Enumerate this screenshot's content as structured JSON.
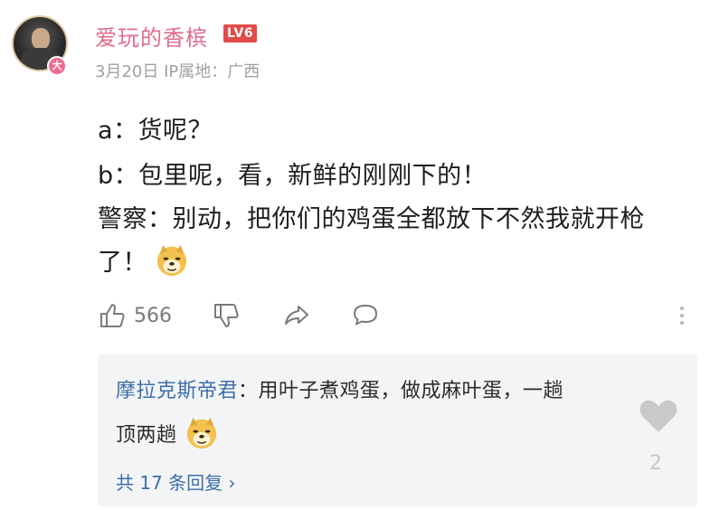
{
  "comment": {
    "avatar_badge": "大",
    "username": "爱玩的香槟",
    "level": "LV6",
    "date": "3月20日",
    "ip_location": "IP属地：广西",
    "lines": [
      "a：货呢？",
      "b：包里呢，看，新鲜的刚刚下的！",
      "警察：别动，把你们的鸡蛋全都放下不然我就开枪",
      "了！"
    ],
    "emoji": "doge-emoji",
    "like_count": "566"
  },
  "reply": {
    "author": "摩拉克斯帝君",
    "separator": "：",
    "text_line1": "用叶子煮鸡蛋，做成麻叶蛋，一趟",
    "text_line2": "顶两趟",
    "more_replies": "共 17 条回复 ›",
    "like_count": "2"
  },
  "colors": {
    "username": "#e06c8c",
    "level_badge": "#e34b4b",
    "reply_author": "#3d6ea8",
    "reply_background": "#f3f4f6",
    "meta_text": "#a0a0a0"
  }
}
